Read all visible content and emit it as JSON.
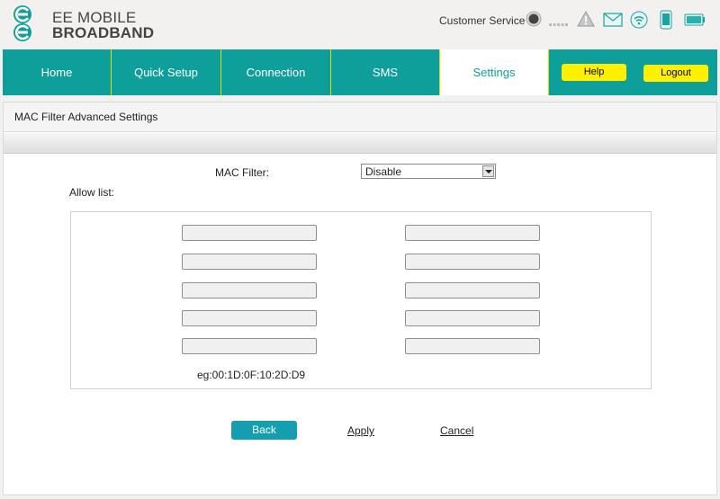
{
  "brand": {
    "line1": "EE MOBILE",
    "line2": "BROADBAND"
  },
  "header": {
    "customer_service": "Customer Service",
    "icons": [
      "signal-status-icon",
      "signal-strength-icon",
      "warning-icon",
      "message-icon",
      "wifi-icon",
      "device-icon",
      "battery-icon"
    ]
  },
  "nav": {
    "tabs": [
      {
        "label": "Home"
      },
      {
        "label": "Quick Setup"
      },
      {
        "label": "Connection"
      },
      {
        "label": "SMS"
      },
      {
        "label": "Settings",
        "active": true
      }
    ],
    "help_label": "Help",
    "logout_label": "Logout"
  },
  "page": {
    "title": "MAC Filter Advanced Settings",
    "mac_filter_label": "MAC Filter:",
    "mac_filter_value": "Disable",
    "allow_list_label": "Allow list:",
    "mac_entries": [
      "",
      "",
      "",
      "",
      "",
      "",
      "",
      "",
      "",
      ""
    ],
    "example": "eg:00:1D:0F:10:2D:D9"
  },
  "actions": {
    "back": "Back",
    "apply": "Apply",
    "cancel": "Cancel"
  },
  "colors": {
    "teal": "#0f9f9a",
    "yellow": "#ffef00",
    "button_blue": "#139fb0"
  }
}
